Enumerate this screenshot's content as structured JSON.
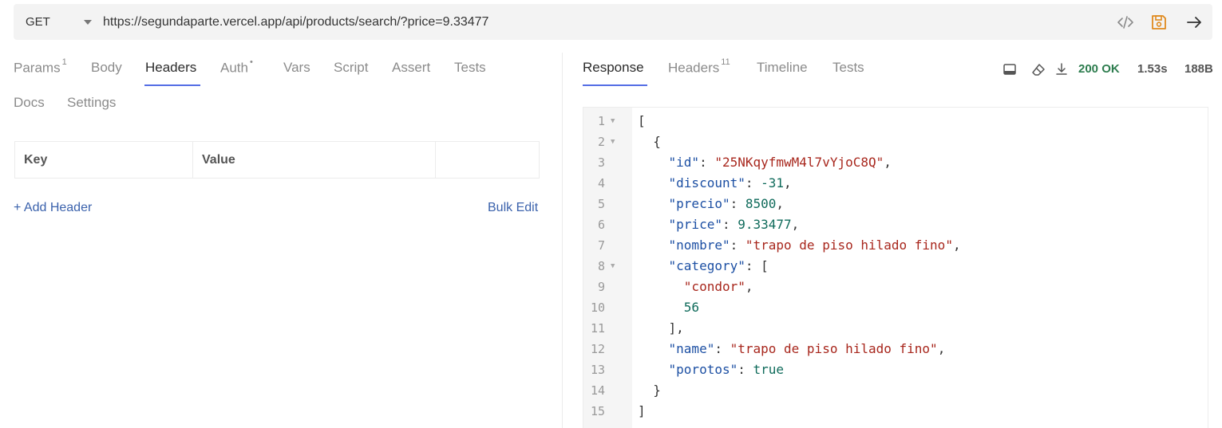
{
  "request": {
    "method": "GET",
    "url": "https://segundaparte.vercel.app/api/products/search/?price=9.33477"
  },
  "request_tabs": [
    {
      "label": "Params",
      "badge": "1"
    },
    {
      "label": "Body",
      "badge": ""
    },
    {
      "label": "Headers",
      "badge": "",
      "active": true
    },
    {
      "label": "Auth",
      "badge": "•"
    },
    {
      "label": "Vars",
      "badge": ""
    },
    {
      "label": "Script",
      "badge": ""
    },
    {
      "label": "Assert",
      "badge": ""
    },
    {
      "label": "Tests",
      "badge": ""
    },
    {
      "label": "Docs",
      "badge": ""
    },
    {
      "label": "Settings",
      "badge": ""
    }
  ],
  "headers_table": {
    "columns": [
      "Key",
      "Value",
      ""
    ],
    "add_label": "+ Add Header",
    "bulk_edit_label": "Bulk Edit"
  },
  "response_tabs": [
    {
      "label": "Response",
      "badge": "",
      "active": true
    },
    {
      "label": "Headers",
      "badge": "11"
    },
    {
      "label": "Timeline",
      "badge": ""
    },
    {
      "label": "Tests",
      "badge": ""
    }
  ],
  "response_status": {
    "status": "200 OK",
    "time": "1.53s",
    "size": "188B",
    "status_color": "#2e7d4f"
  },
  "accent_color": "#546de5",
  "icons": [
    "code-icon",
    "save-icon",
    "send-arrow-icon",
    "panel-icon",
    "eraser-icon",
    "download-icon"
  ],
  "response_lines": [
    {
      "n": "1",
      "fold": true,
      "text": "["
    },
    {
      "n": "2",
      "fold": true,
      "text": "  {"
    },
    {
      "n": "3",
      "fold": false,
      "key": "id",
      "value": "\"25NKqyfmwM4l7vYjoC8Q\"",
      "vtype": "s",
      "indent": "    ",
      "trail": ","
    },
    {
      "n": "4",
      "fold": false,
      "key": "discount",
      "value": "-31",
      "vtype": "n",
      "indent": "    ",
      "trail": ","
    },
    {
      "n": "5",
      "fold": false,
      "key": "precio",
      "value": "8500",
      "vtype": "n",
      "indent": "    ",
      "trail": ","
    },
    {
      "n": "6",
      "fold": false,
      "key": "price",
      "value": "9.33477",
      "vtype": "n",
      "indent": "    ",
      "trail": ","
    },
    {
      "n": "7",
      "fold": false,
      "key": "nombre",
      "value": "\"trapo de piso hilado fino\"",
      "vtype": "s",
      "indent": "    ",
      "trail": ","
    },
    {
      "n": "8",
      "fold": true,
      "key": "category",
      "value": "[",
      "vtype": "p",
      "indent": "    ",
      "trail": ""
    },
    {
      "n": "9",
      "fold": false,
      "value": "\"condor\"",
      "vtype": "s",
      "indent": "      ",
      "trail": ","
    },
    {
      "n": "10",
      "fold": false,
      "value": "56",
      "vtype": "n",
      "indent": "      ",
      "trail": ""
    },
    {
      "n": "11",
      "fold": false,
      "text": "    ],"
    },
    {
      "n": "12",
      "fold": false,
      "key": "name",
      "value": "\"trapo de piso hilado fino\"",
      "vtype": "s",
      "indent": "    ",
      "trail": ","
    },
    {
      "n": "13",
      "fold": false,
      "key": "porotos",
      "value": "true",
      "vtype": "b",
      "indent": "    ",
      "trail": ""
    },
    {
      "n": "14",
      "fold": false,
      "text": "  }"
    },
    {
      "n": "15",
      "fold": false,
      "text": "]"
    }
  ]
}
